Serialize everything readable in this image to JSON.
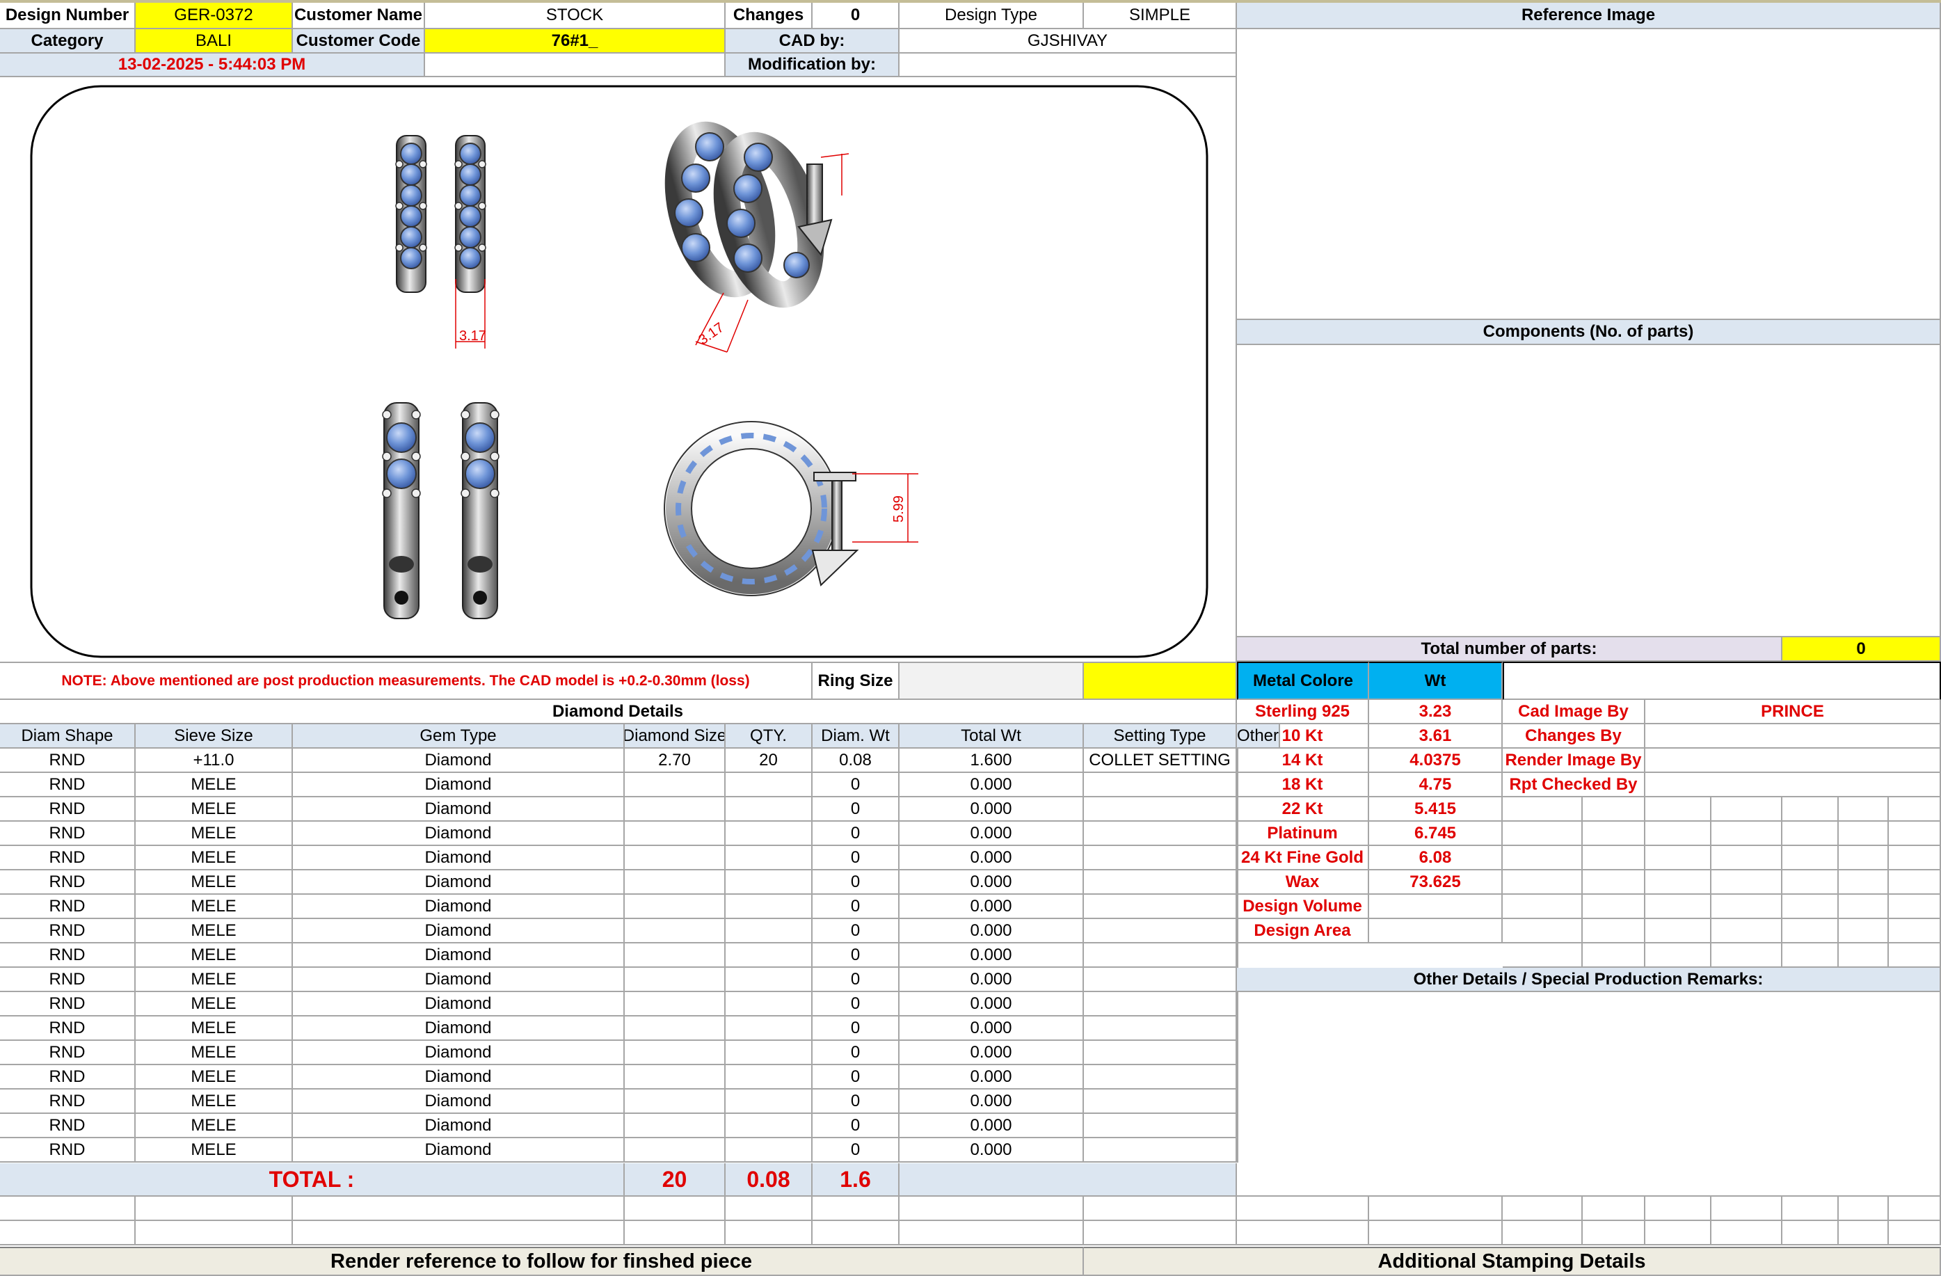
{
  "header": {
    "design_number_label": "Design Number",
    "design_number": "GER-0372",
    "customer_name_label": "Customer Name",
    "customer_name": "STOCK",
    "changes_label": "Changes",
    "changes": "0",
    "design_type_label": "Design Type",
    "design_type": "SIMPLE",
    "category_label": "Category",
    "category": "BALI",
    "customer_code_label": "Customer Code",
    "customer_code": "76#1_",
    "cad_by_label": "CAD by:",
    "cad_by": "GJSHIVAY",
    "timestamp": "13-02-2025 - 5:44:03 PM",
    "modification_by_label": "Modification by:",
    "modification_by": ""
  },
  "cad": {
    "dim_side": "3.17",
    "dim_persp": "3.17",
    "dim_front": "5.99"
  },
  "note": "NOTE: Above mentioned are post production measurements. The CAD model is +0.2-0.30mm (loss)",
  "ring_size_label": "Ring Size",
  "ring_size": "",
  "diamond": {
    "title": "Diamond Details",
    "columns": [
      "Diam Shape",
      "Sieve Size",
      "Gem Type",
      "Diamond Size",
      "QTY.",
      "Diam. Wt",
      "Total Wt",
      "Setting Type",
      "Other"
    ],
    "rows": [
      [
        "RND",
        "+11.0",
        "Diamond",
        "2.70",
        "20",
        "0.08",
        "1.600",
        "COLLET SETTING",
        ""
      ],
      [
        "RND",
        "MELE",
        "Diamond",
        "",
        "",
        "0",
        "0.000",
        "",
        ""
      ],
      [
        "RND",
        "MELE",
        "Diamond",
        "",
        "",
        "0",
        "0.000",
        "",
        ""
      ],
      [
        "RND",
        "MELE",
        "Diamond",
        "",
        "",
        "0",
        "0.000",
        "",
        ""
      ],
      [
        "RND",
        "MELE",
        "Diamond",
        "",
        "",
        "0",
        "0.000",
        "",
        ""
      ],
      [
        "RND",
        "MELE",
        "Diamond",
        "",
        "",
        "0",
        "0.000",
        "",
        ""
      ],
      [
        "RND",
        "MELE",
        "Diamond",
        "",
        "",
        "0",
        "0.000",
        "",
        ""
      ],
      [
        "RND",
        "MELE",
        "Diamond",
        "",
        "",
        "0",
        "0.000",
        "",
        ""
      ],
      [
        "RND",
        "MELE",
        "Diamond",
        "",
        "",
        "0",
        "0.000",
        "",
        ""
      ],
      [
        "RND",
        "MELE",
        "Diamond",
        "",
        "",
        "0",
        "0.000",
        "",
        ""
      ],
      [
        "RND",
        "MELE",
        "Diamond",
        "",
        "",
        "0",
        "0.000",
        "",
        ""
      ],
      [
        "RND",
        "MELE",
        "Diamond",
        "",
        "",
        "0",
        "0.000",
        "",
        ""
      ],
      [
        "RND",
        "MELE",
        "Diamond",
        "",
        "",
        "0",
        "0.000",
        "",
        ""
      ],
      [
        "RND",
        "MELE",
        "Diamond",
        "",
        "",
        "0",
        "0.000",
        "",
        ""
      ],
      [
        "RND",
        "MELE",
        "Diamond",
        "",
        "",
        "0",
        "0.000",
        "",
        ""
      ],
      [
        "RND",
        "MELE",
        "Diamond",
        "",
        "",
        "0",
        "0.000",
        "",
        ""
      ],
      [
        "RND",
        "MELE",
        "Diamond",
        "",
        "",
        "0",
        "0.000",
        "",
        ""
      ]
    ],
    "total_label": "TOTAL :",
    "total_qty": "20",
    "total_diam_wt": "0.08",
    "total_wt": "1.6"
  },
  "right": {
    "reference_image_label": "Reference Image",
    "components_label": "Components (No. of parts)",
    "total_parts_label": "Total number of parts:",
    "total_parts": "0",
    "metal_colore_label": "Metal Colore",
    "wt_label": "Wt",
    "metals": [
      {
        "name": "Sterling 925",
        "wt": "3.23"
      },
      {
        "name": "10 Kt",
        "wt": "3.61"
      },
      {
        "name": "14 Kt",
        "wt": "4.0375"
      },
      {
        "name": "18 Kt",
        "wt": "4.75"
      },
      {
        "name": "22 Kt",
        "wt": "5.415"
      },
      {
        "name": "Platinum",
        "wt": "6.745"
      },
      {
        "name": "24 Kt Fine Gold",
        "wt": "6.08"
      },
      {
        "name": "Wax",
        "wt": "73.625"
      },
      {
        "name": "Design Volume",
        "wt": ""
      },
      {
        "name": "Design Area",
        "wt": ""
      }
    ],
    "cad_image_by_label": "Cad Image By",
    "cad_image_by": "PRINCE",
    "changes_by_label": "Changes By",
    "render_image_by_label": "Render Image By",
    "rpt_checked_by_label": "Rpt Checked By",
    "other_details_label": "Other Details / Special Production Remarks:"
  },
  "footer": {
    "render_reference": "Render reference to follow for finshed piece",
    "additional_stamping": "Additional Stamping Details"
  },
  "colors": {
    "header_blue": "#dce6f1",
    "yellow": "#ffff00",
    "metal_header_blue": "#00b0f0",
    "red_text": "#e00000",
    "footer_tan": "#eeece1",
    "gem_blue": "#6f95d8"
  }
}
